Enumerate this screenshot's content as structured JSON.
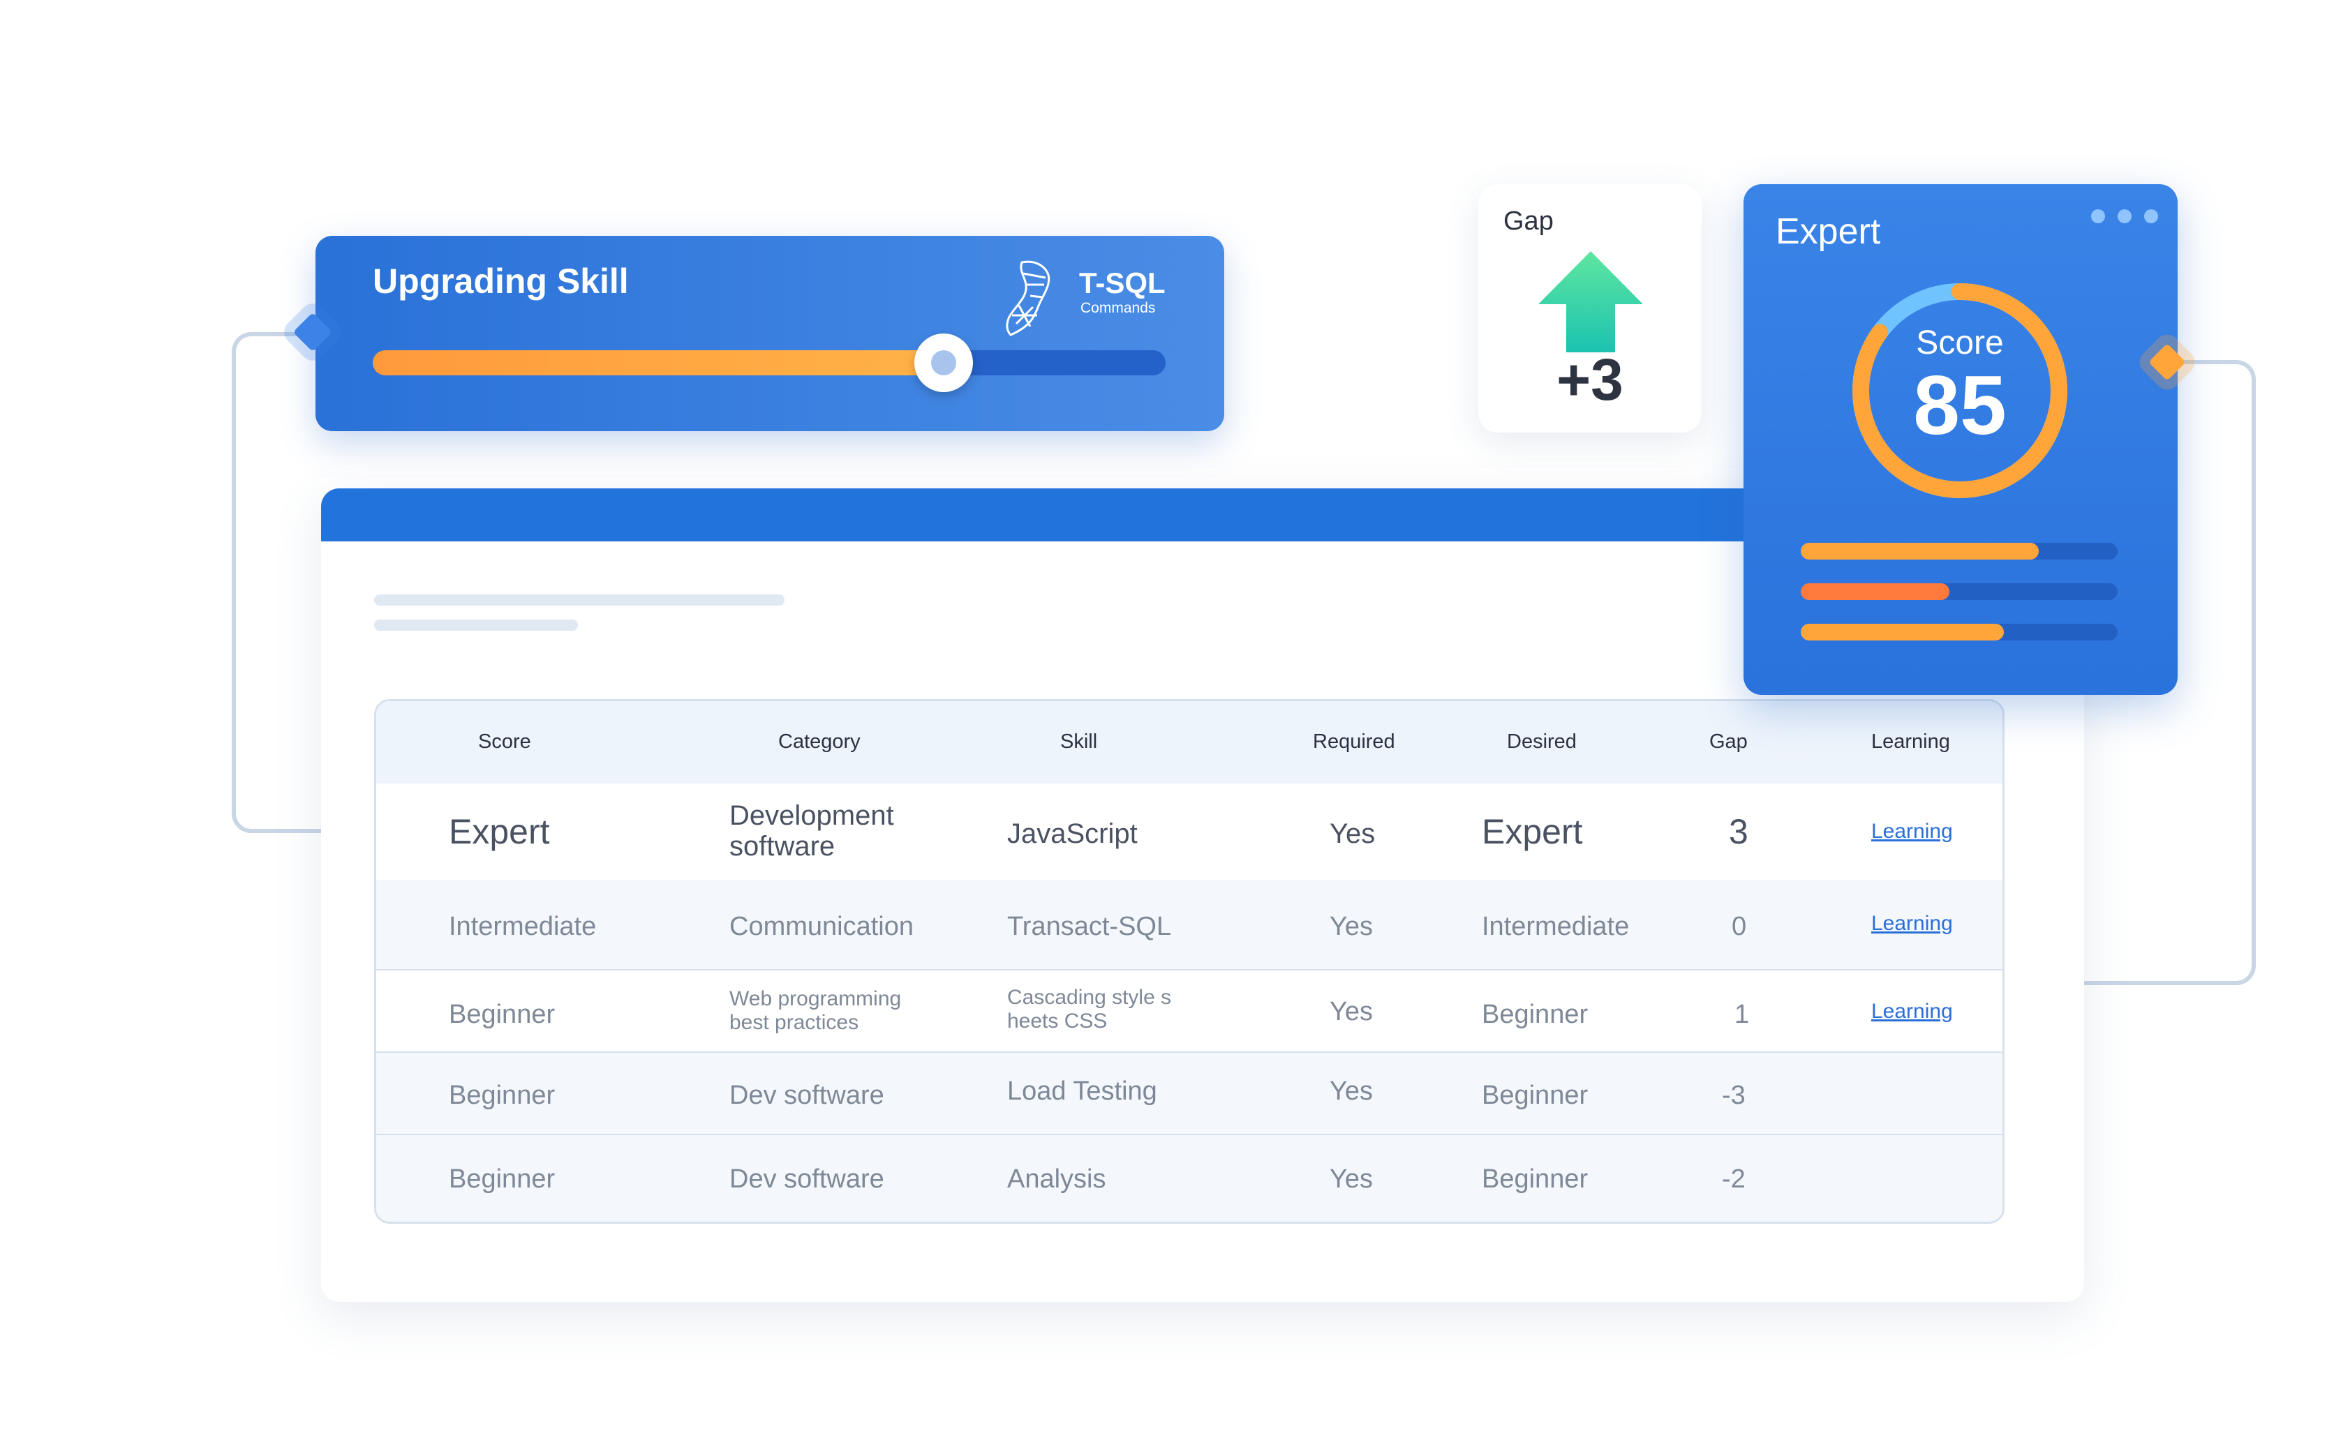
{
  "skill_card": {
    "title": "Upgrading Skill",
    "logo_text": "T-SQL",
    "logo_subtext": "Commands",
    "progress_fraction": 0.72
  },
  "gap_card": {
    "label": "Gap",
    "value": "+3",
    "icon": "arrow-up-icon"
  },
  "expert_card": {
    "title": "Expert",
    "score_label": "Score",
    "score_value": "85",
    "score_fraction": 0.85,
    "bars": [
      {
        "fraction": 0.75,
        "color": "#ffa53a"
      },
      {
        "fraction": 0.47,
        "color": "#ff7a3c"
      },
      {
        "fraction": 0.64,
        "color": "#ffa53a"
      }
    ]
  },
  "table": {
    "headers": [
      "Score",
      "Category",
      "Skill",
      "Required",
      "Desired",
      "Gap",
      "Learning"
    ],
    "rows": [
      {
        "score": "Expert",
        "category_1": "Development",
        "category_2": "software",
        "skill": "JavaScript",
        "required": "Yes",
        "desired": "Expert",
        "gap": "3",
        "learning": "Learning"
      },
      {
        "score": "Intermediate",
        "category": "Communication",
        "skill": "Transact-SQL",
        "required": "Yes",
        "desired": "Intermediate",
        "gap": "0",
        "learning": "Learning"
      },
      {
        "score": "Beginner",
        "category_1": "Web programming",
        "category_2": "best practices",
        "skill_1": "Cascading style s",
        "skill_2": "heets CSS",
        "required": "Yes",
        "desired": "Beginner",
        "gap": "1",
        "learning": "Learning"
      },
      {
        "score": "Beginner",
        "category": "Dev software",
        "skill": "Load Testing",
        "required": "Yes",
        "desired": "Beginner",
        "gap": "-3"
      },
      {
        "score": "Beginner",
        "category": "Dev software",
        "skill": "Analysis",
        "required": "Yes",
        "desired": "Beginner",
        "gap": "-2"
      }
    ]
  },
  "colors": {
    "primary_blue": "#2273db",
    "accent_orange": "#ffa53a",
    "gap_green": "#2fd6a2"
  }
}
